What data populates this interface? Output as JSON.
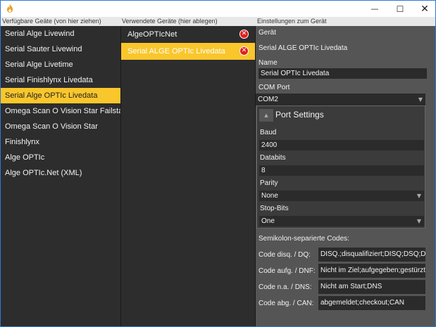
{
  "window": {
    "minimize_glyph": "—",
    "maximize_glyph": "☐",
    "close_glyph": "✕",
    "icon": "app-flame-icon"
  },
  "headers": {
    "available": "Verfügbare Geäte (von hier ziehen)",
    "used": "Verwendete Geräte (hier ablegen)",
    "settings": "Einstellungen zum Gerät"
  },
  "available_devices": [
    {
      "label": "Serial Alge Livewind"
    },
    {
      "label": "Serial Sauter Livewind"
    },
    {
      "label": "Serial Alge Livetime"
    },
    {
      "label": "Serial Finishlynx Livedata"
    },
    {
      "label": "Serial Alge OPTIc Livedata",
      "selected": true
    },
    {
      "label": "Omega Scan O Vision Star Failstart"
    },
    {
      "label": "Omega Scan O Vision Star"
    },
    {
      "label": "Finishlynx"
    },
    {
      "label": "Alge OPTIc"
    },
    {
      "label": "Alge OPTIc.Net (XML)"
    }
  ],
  "used_devices": [
    {
      "label": "AlgeOPTIcNet",
      "remove_icon": "remove-icon"
    },
    {
      "label": "Serial ALGE OPTIc Livedata",
      "selected": true,
      "remove_icon": "remove-icon"
    }
  ],
  "settings": {
    "device_label": "Gerät",
    "device_value": "Serial ALGE OPTIc Livedata",
    "name_label": "Name",
    "name_value": "Serial OPTIc Livedata",
    "com_port_label": "COM Port",
    "com_port_value": "COM2",
    "port_settings": {
      "title": "Port Settings",
      "baud_label": "Baud",
      "baud_value": "2400",
      "databits_label": "Databits",
      "databits_value": "8",
      "parity_label": "Parity",
      "parity_value": "None",
      "stopbits_label": "Stop-Bits",
      "stopbits_value": "One"
    },
    "codes_title": "Semikolon-separierte Codes:",
    "codes": [
      {
        "label": "Code disq. / DQ:",
        "value": "DISQ.;disqualifiziert;DISQ;DSQ;DQ"
      },
      {
        "label": "Code aufg. / DNF:",
        "value": "Nicht im Ziel;aufgegeben;gestürzt;"
      },
      {
        "label": "Code n.a.  / DNS:",
        "value": "Nicht am Start;DNS"
      },
      {
        "label": "Code abg. / CAN:",
        "value": "abgemeldet;checkout;CAN"
      }
    ]
  },
  "colors": {
    "accent": "#f9c62c",
    "panel_dark": "#2d2d2d",
    "settings_bg": "#555555",
    "remove_red": "#e02020"
  }
}
